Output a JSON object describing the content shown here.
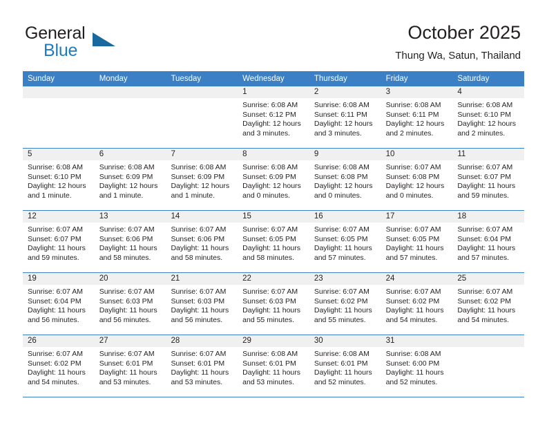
{
  "brand": {
    "name_part1": "General",
    "name_part2": "Blue",
    "triangle_color": "#17699f",
    "blue_color": "#1f7bc1"
  },
  "header": {
    "title": "October 2025",
    "subtitle": "Thung Wa, Satun, Thailand"
  },
  "theme": {
    "header_blue": "#3b7fc4",
    "day_number_bg": "#f0f0f0",
    "text": "#231f20"
  },
  "calendar": {
    "day_headers": [
      "Sunday",
      "Monday",
      "Tuesday",
      "Wednesday",
      "Thursday",
      "Friday",
      "Saturday"
    ],
    "weeks": [
      [
        {
          "day": "",
          "sunrise": "",
          "sunset": "",
          "daylight": ""
        },
        {
          "day": "",
          "sunrise": "",
          "sunset": "",
          "daylight": ""
        },
        {
          "day": "",
          "sunrise": "",
          "sunset": "",
          "daylight": ""
        },
        {
          "day": "1",
          "sunrise": "Sunrise: 6:08 AM",
          "sunset": "Sunset: 6:12 PM",
          "daylight": "Daylight: 12 hours and 3 minutes."
        },
        {
          "day": "2",
          "sunrise": "Sunrise: 6:08 AM",
          "sunset": "Sunset: 6:11 PM",
          "daylight": "Daylight: 12 hours and 3 minutes."
        },
        {
          "day": "3",
          "sunrise": "Sunrise: 6:08 AM",
          "sunset": "Sunset: 6:11 PM",
          "daylight": "Daylight: 12 hours and 2 minutes."
        },
        {
          "day": "4",
          "sunrise": "Sunrise: 6:08 AM",
          "sunset": "Sunset: 6:10 PM",
          "daylight": "Daylight: 12 hours and 2 minutes."
        }
      ],
      [
        {
          "day": "5",
          "sunrise": "Sunrise: 6:08 AM",
          "sunset": "Sunset: 6:10 PM",
          "daylight": "Daylight: 12 hours and 1 minute."
        },
        {
          "day": "6",
          "sunrise": "Sunrise: 6:08 AM",
          "sunset": "Sunset: 6:09 PM",
          "daylight": "Daylight: 12 hours and 1 minute."
        },
        {
          "day": "7",
          "sunrise": "Sunrise: 6:08 AM",
          "sunset": "Sunset: 6:09 PM",
          "daylight": "Daylight: 12 hours and 1 minute."
        },
        {
          "day": "8",
          "sunrise": "Sunrise: 6:08 AM",
          "sunset": "Sunset: 6:09 PM",
          "daylight": "Daylight: 12 hours and 0 minutes."
        },
        {
          "day": "9",
          "sunrise": "Sunrise: 6:08 AM",
          "sunset": "Sunset: 6:08 PM",
          "daylight": "Daylight: 12 hours and 0 minutes."
        },
        {
          "day": "10",
          "sunrise": "Sunrise: 6:07 AM",
          "sunset": "Sunset: 6:08 PM",
          "daylight": "Daylight: 12 hours and 0 minutes."
        },
        {
          "day": "11",
          "sunrise": "Sunrise: 6:07 AM",
          "sunset": "Sunset: 6:07 PM",
          "daylight": "Daylight: 11 hours and 59 minutes."
        }
      ],
      [
        {
          "day": "12",
          "sunrise": "Sunrise: 6:07 AM",
          "sunset": "Sunset: 6:07 PM",
          "daylight": "Daylight: 11 hours and 59 minutes."
        },
        {
          "day": "13",
          "sunrise": "Sunrise: 6:07 AM",
          "sunset": "Sunset: 6:06 PM",
          "daylight": "Daylight: 11 hours and 58 minutes."
        },
        {
          "day": "14",
          "sunrise": "Sunrise: 6:07 AM",
          "sunset": "Sunset: 6:06 PM",
          "daylight": "Daylight: 11 hours and 58 minutes."
        },
        {
          "day": "15",
          "sunrise": "Sunrise: 6:07 AM",
          "sunset": "Sunset: 6:05 PM",
          "daylight": "Daylight: 11 hours and 58 minutes."
        },
        {
          "day": "16",
          "sunrise": "Sunrise: 6:07 AM",
          "sunset": "Sunset: 6:05 PM",
          "daylight": "Daylight: 11 hours and 57 minutes."
        },
        {
          "day": "17",
          "sunrise": "Sunrise: 6:07 AM",
          "sunset": "Sunset: 6:05 PM",
          "daylight": "Daylight: 11 hours and 57 minutes."
        },
        {
          "day": "18",
          "sunrise": "Sunrise: 6:07 AM",
          "sunset": "Sunset: 6:04 PM",
          "daylight": "Daylight: 11 hours and 57 minutes."
        }
      ],
      [
        {
          "day": "19",
          "sunrise": "Sunrise: 6:07 AM",
          "sunset": "Sunset: 6:04 PM",
          "daylight": "Daylight: 11 hours and 56 minutes."
        },
        {
          "day": "20",
          "sunrise": "Sunrise: 6:07 AM",
          "sunset": "Sunset: 6:03 PM",
          "daylight": "Daylight: 11 hours and 56 minutes."
        },
        {
          "day": "21",
          "sunrise": "Sunrise: 6:07 AM",
          "sunset": "Sunset: 6:03 PM",
          "daylight": "Daylight: 11 hours and 56 minutes."
        },
        {
          "day": "22",
          "sunrise": "Sunrise: 6:07 AM",
          "sunset": "Sunset: 6:03 PM",
          "daylight": "Daylight: 11 hours and 55 minutes."
        },
        {
          "day": "23",
          "sunrise": "Sunrise: 6:07 AM",
          "sunset": "Sunset: 6:02 PM",
          "daylight": "Daylight: 11 hours and 55 minutes."
        },
        {
          "day": "24",
          "sunrise": "Sunrise: 6:07 AM",
          "sunset": "Sunset: 6:02 PM",
          "daylight": "Daylight: 11 hours and 54 minutes."
        },
        {
          "day": "25",
          "sunrise": "Sunrise: 6:07 AM",
          "sunset": "Sunset: 6:02 PM",
          "daylight": "Daylight: 11 hours and 54 minutes."
        }
      ],
      [
        {
          "day": "26",
          "sunrise": "Sunrise: 6:07 AM",
          "sunset": "Sunset: 6:02 PM",
          "daylight": "Daylight: 11 hours and 54 minutes."
        },
        {
          "day": "27",
          "sunrise": "Sunrise: 6:07 AM",
          "sunset": "Sunset: 6:01 PM",
          "daylight": "Daylight: 11 hours and 53 minutes."
        },
        {
          "day": "28",
          "sunrise": "Sunrise: 6:07 AM",
          "sunset": "Sunset: 6:01 PM",
          "daylight": "Daylight: 11 hours and 53 minutes."
        },
        {
          "day": "29",
          "sunrise": "Sunrise: 6:08 AM",
          "sunset": "Sunset: 6:01 PM",
          "daylight": "Daylight: 11 hours and 53 minutes."
        },
        {
          "day": "30",
          "sunrise": "Sunrise: 6:08 AM",
          "sunset": "Sunset: 6:01 PM",
          "daylight": "Daylight: 11 hours and 52 minutes."
        },
        {
          "day": "31",
          "sunrise": "Sunrise: 6:08 AM",
          "sunset": "Sunset: 6:00 PM",
          "daylight": "Daylight: 11 hours and 52 minutes."
        },
        {
          "day": "",
          "sunrise": "",
          "sunset": "",
          "daylight": ""
        }
      ]
    ]
  }
}
